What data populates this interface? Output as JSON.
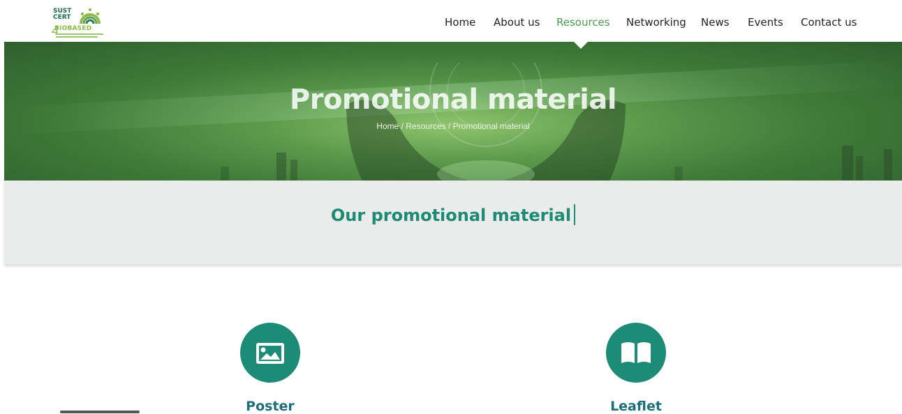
{
  "nav": {
    "items": [
      {
        "label": "Home",
        "active": false
      },
      {
        "label": "About us",
        "active": false
      },
      {
        "label": "Resources",
        "active": true
      },
      {
        "label": "Networking",
        "active": false
      },
      {
        "label": "News",
        "active": false
      },
      {
        "label": "Events",
        "active": false
      },
      {
        "label": "Contact us",
        "active": false
      }
    ],
    "active_color": "#4a9a4e"
  },
  "logo": {
    "line1": "SUST",
    "line2": "CERT",
    "line3": "BIOBASED",
    "number": "4"
  },
  "hero": {
    "title": "Promotional material",
    "breadcrumb": "Home / Resources / Promotional material"
  },
  "section": {
    "title": "Our promotional material"
  },
  "cards": [
    {
      "label": "Poster",
      "icon": "image-icon"
    },
    {
      "label": "Leaflet",
      "icon": "book-icon"
    }
  ],
  "colors": {
    "accent": "#1c8c77",
    "heading": "#1d8a74",
    "band_bg": "#e9ecea"
  }
}
